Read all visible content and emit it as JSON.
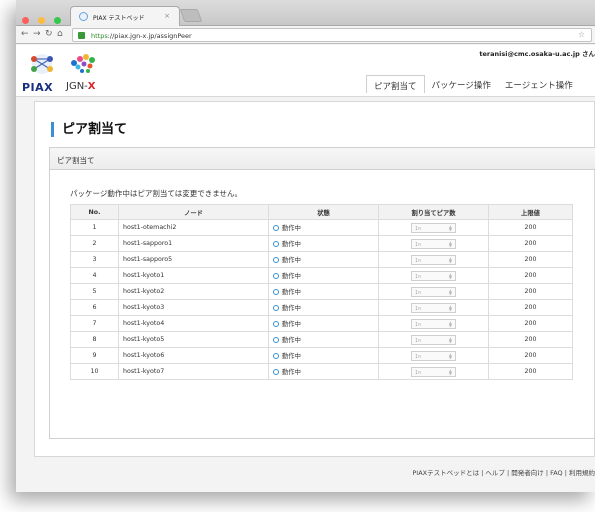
{
  "browser": {
    "tab_title": "PIAX テストベッド",
    "url_scheme": "https",
    "url_rest": "://piax.jgn-x.jp/assignPeer"
  },
  "header": {
    "user_email": "teranisi@cmc.osaka-u.ac.jp さん",
    "logo_piax": "PIAX",
    "logo_jgn_prefix": "JGN-",
    "logo_jgn_x": "X",
    "nav": [
      "ピア割当て",
      "パッケージ操作",
      "エージェント操作"
    ]
  },
  "main": {
    "page_title": "ピア割当て",
    "panel_title": "ピア割当て",
    "notice": "パッケージ動作中はピア割当ては変更できません。",
    "table": {
      "headers": [
        "No.",
        "ノード",
        "状態",
        "割り当てピア数",
        "上限値"
      ],
      "rows": [
        {
          "no": "1",
          "node": "host1-otemachi2",
          "status": "動作中",
          "peers": "1n",
          "limit": "200"
        },
        {
          "no": "2",
          "node": "host1-sapporo1",
          "status": "動作中",
          "peers": "1n",
          "limit": "200"
        },
        {
          "no": "3",
          "node": "host1-sapporo5",
          "status": "動作中",
          "peers": "1n",
          "limit": "200"
        },
        {
          "no": "4",
          "node": "host1-kyoto1",
          "status": "動作中",
          "peers": "1n",
          "limit": "200"
        },
        {
          "no": "5",
          "node": "host1-kyoto2",
          "status": "動作中",
          "peers": "1n",
          "limit": "200"
        },
        {
          "no": "6",
          "node": "host1-kyoto3",
          "status": "動作中",
          "peers": "1n",
          "limit": "200"
        },
        {
          "no": "7",
          "node": "host1-kyoto4",
          "status": "動作中",
          "peers": "1n",
          "limit": "200"
        },
        {
          "no": "8",
          "node": "host1-kyoto5",
          "status": "動作中",
          "peers": "1n",
          "limit": "200"
        },
        {
          "no": "9",
          "node": "host1-kyoto6",
          "status": "動作中",
          "peers": "1n",
          "limit": "200"
        },
        {
          "no": "10",
          "node": "host1-kyoto7",
          "status": "動作中",
          "peers": "1n",
          "limit": "200"
        }
      ]
    }
  },
  "footer": {
    "links": "PIAXテストベッドとは | ヘルプ | 開発者向け | FAQ | 利用規約"
  },
  "colors": {
    "accent": "#3c8ed6",
    "piax_navy": "#1a2e80",
    "jgn_red": "#d8242b"
  }
}
